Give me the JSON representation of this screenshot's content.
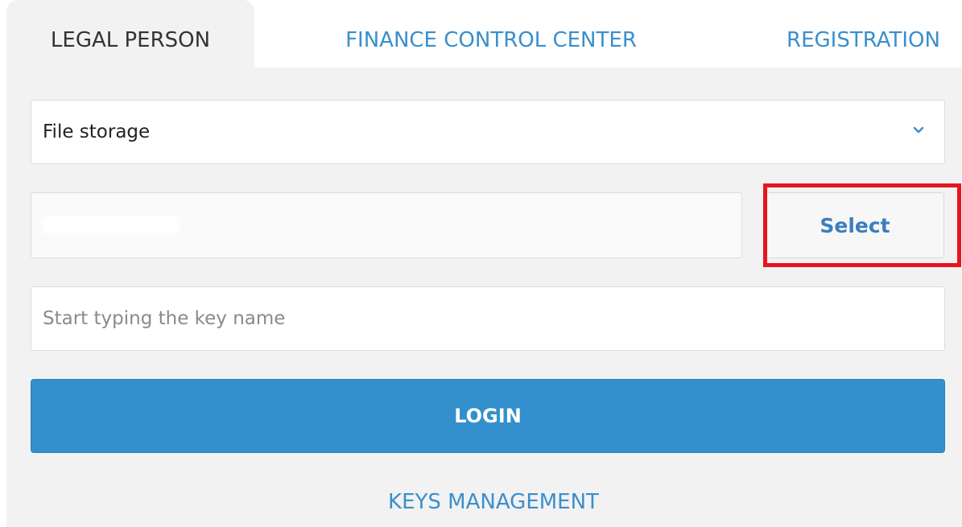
{
  "tabs": [
    {
      "label": "LEGAL PERSON",
      "active": true
    },
    {
      "label": "FINANCE CONTROL CENTER",
      "active": false
    },
    {
      "label": "REGISTRATION",
      "active": false
    }
  ],
  "form": {
    "storage_select": {
      "value": "File storage"
    },
    "file_path": {
      "value": ""
    },
    "select_button": {
      "label": "Select"
    },
    "key_input": {
      "placeholder": "Start typing the key name",
      "value": ""
    },
    "login_button": {
      "label": "LOGIN"
    }
  },
  "links": {
    "keys_management": "KEYS MANAGEMENT"
  },
  "colors": {
    "accent": "#3390cd",
    "link": "#3a8fcc",
    "highlight": "#e8141e",
    "panel_bg": "#f2f2f2"
  },
  "icons": {
    "dropdown": "chevron-down-icon"
  }
}
